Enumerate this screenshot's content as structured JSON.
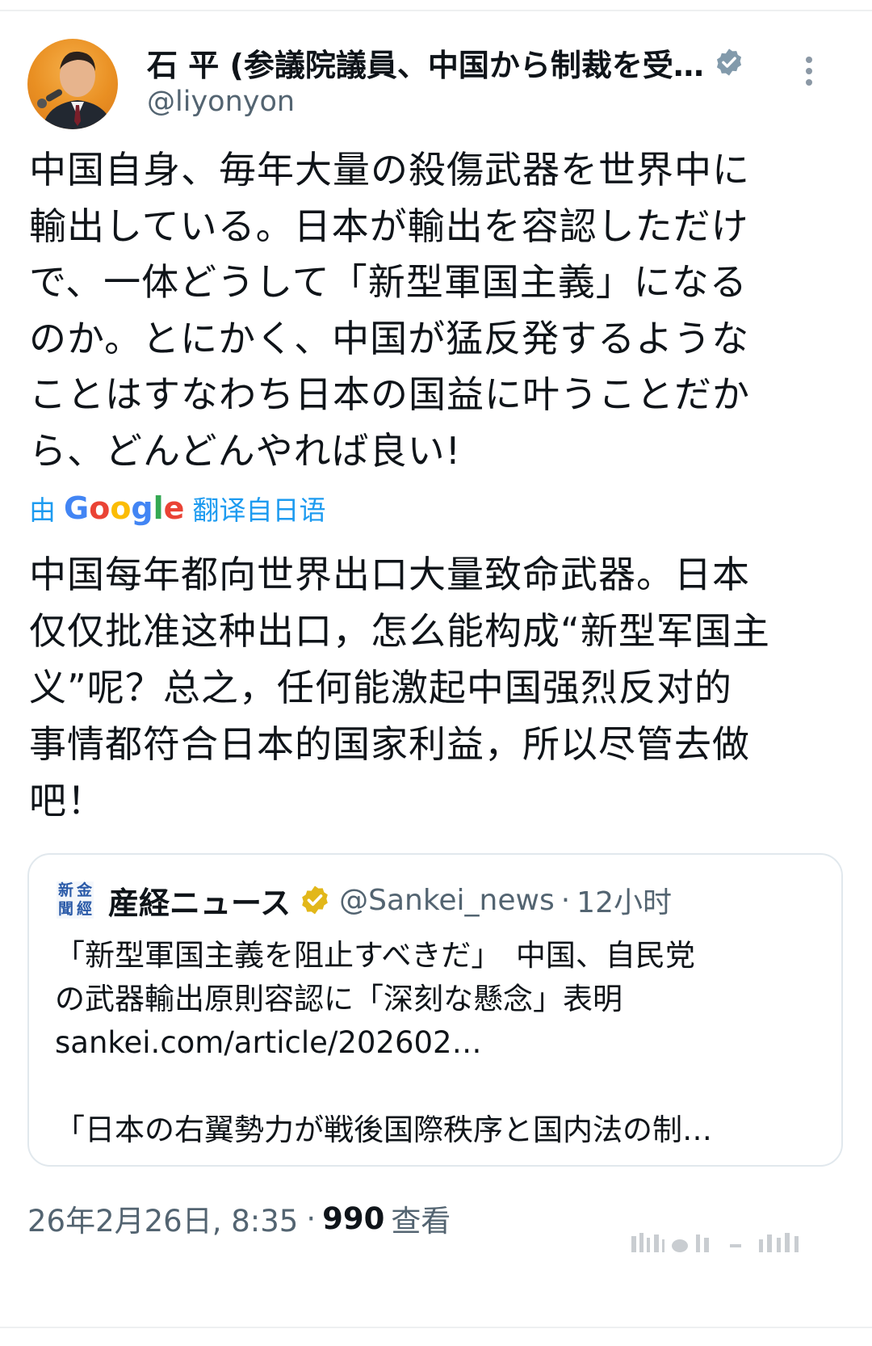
{
  "author": {
    "name": "石 平 (参議院議員、中国から制裁を受…",
    "handle": "@liyonyon",
    "verified_color": "#829aab"
  },
  "post": {
    "lines": [
      "中国自身、毎年大量の殺傷武器を世界中に",
      "輸出している。日本が輸出を容認しただけ",
      "で、一体どうして「新型軍国主義」になる",
      "のか。とにかく、中国が猛反発するような",
      "ことはすなわち日本の国益に叶うことだか",
      "ら、どんどんやれば良い!"
    ]
  },
  "translate": {
    "prefix": "由",
    "google_letters": [
      "G",
      "o",
      "o",
      "g",
      "l",
      "e"
    ],
    "suffix": "翻译自日语",
    "link_color": "#1d9bf0"
  },
  "translation": {
    "lines": [
      "中国每年都向世界出口大量致命武器。日本",
      "仅仅批准这种出口，怎么能构成“新型军国主",
      "义”呢？总之，任何能激起中国强烈反对的",
      "事情都符合日本的国家利益，所以尽管去做",
      "吧！"
    ]
  },
  "quote": {
    "logo_chars": [
      "金",
      "經",
      "新",
      "聞"
    ],
    "name": "産経ニュース",
    "handle": "@Sankei_news",
    "separator": "·",
    "time": "12小时",
    "badge_color": "#e2b719",
    "lines": [
      "「新型軍国主義を阻止すべきだ」　中国、自民党",
      "の武器輸出原則容認に「深刻な懸念」表明",
      "sankei.com/article/202602…",
      "",
      "「日本の右翼勢力が戦後国際秩序と国内法の制…"
    ]
  },
  "footer": {
    "datetime": "26年2月26日, 8:35",
    "separator": "·",
    "views": "990",
    "views_label": "查看"
  }
}
